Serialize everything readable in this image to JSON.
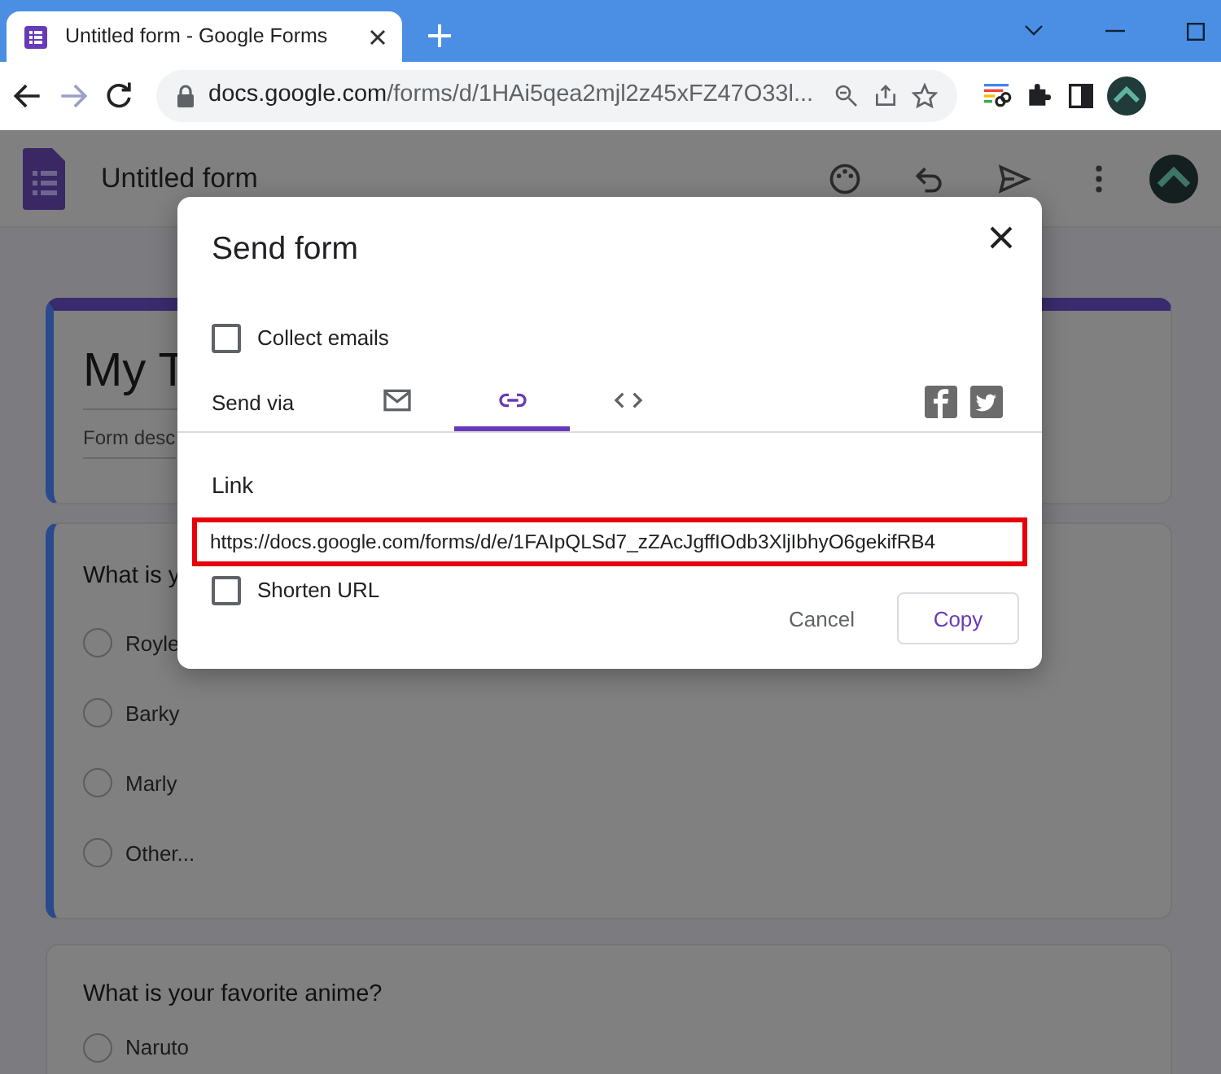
{
  "browser": {
    "tab": {
      "title": "Untitled form - Google Forms"
    },
    "address": "docs.google.com/forms/d/1HAi5qea2mjl2z45xFZ47O33l..."
  },
  "app_bar": {
    "title": "Untitled form"
  },
  "form": {
    "title": "My T",
    "description": "Form desc",
    "questions": [
      {
        "text": "What is y",
        "options": [
          {
            "label": "Royle",
            "selected": false
          },
          {
            "label": "Barky",
            "selected": false
          },
          {
            "label": "Marly",
            "selected": false
          },
          {
            "label": "Other...",
            "selected": false
          }
        ]
      },
      {
        "text": "What is your favorite anime?",
        "options": [
          {
            "label": "Naruto",
            "selected": false
          }
        ]
      }
    ]
  },
  "dialog": {
    "title": "Send form",
    "collect_emails": {
      "label": "Collect emails",
      "checked": false
    },
    "send_via": {
      "label": "Send via",
      "methods": [
        {
          "kind": "email",
          "selected": false
        },
        {
          "kind": "link",
          "selected": true
        },
        {
          "kind": "embed",
          "selected": false
        }
      ]
    },
    "link": {
      "heading": "Link",
      "value": "https://docs.google.com/forms/d/e/1FAIpQLSd7_zZAcJgffIOdb3XljIbhyO6gekifRB4",
      "shorten_url": {
        "label": "Shorten URL",
        "checked": false
      }
    },
    "buttons": [
      {
        "label": "Cancel",
        "kind": "text"
      },
      {
        "label": "Copy",
        "kind": "outlined"
      }
    ]
  }
}
